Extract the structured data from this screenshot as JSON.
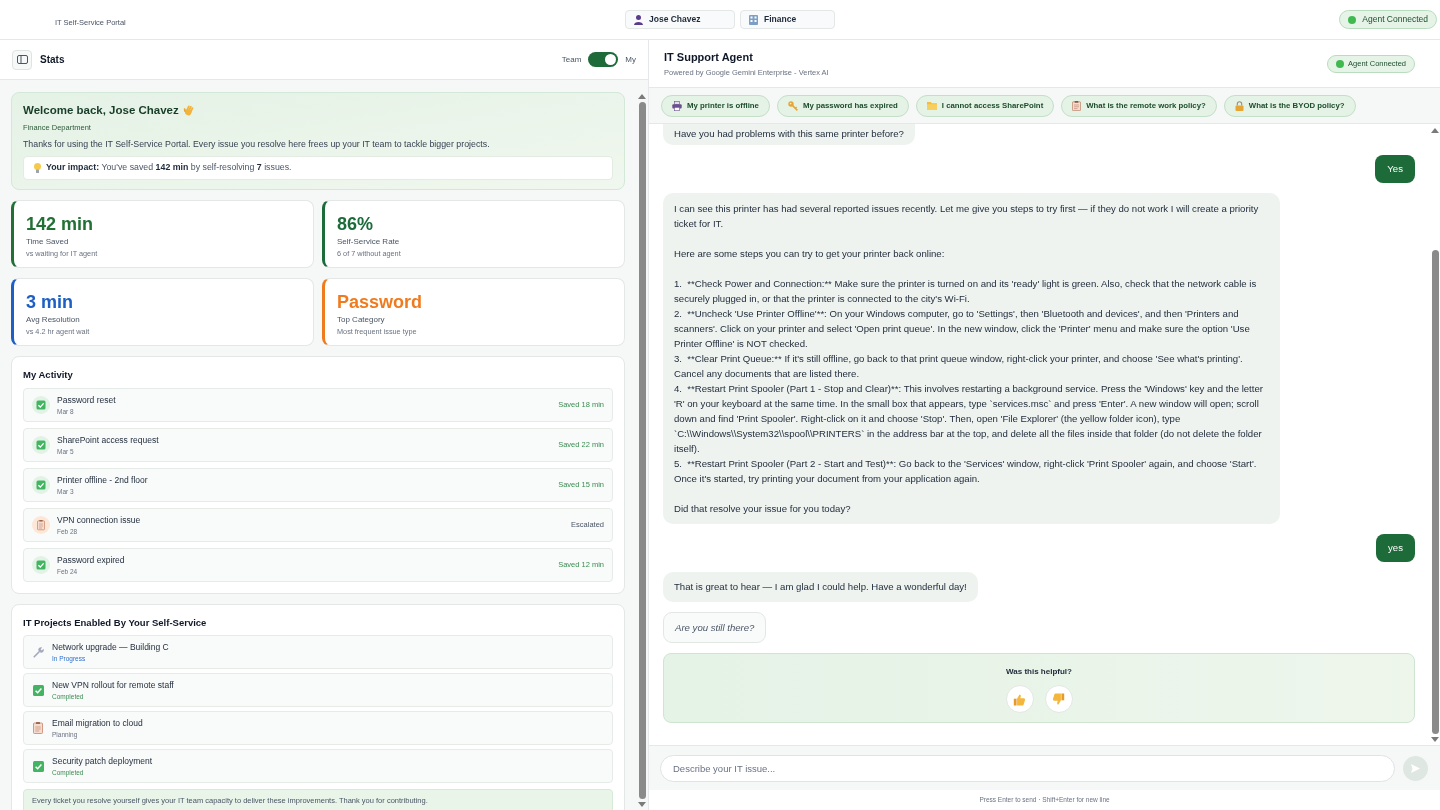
{
  "top_bar": {
    "app_title": "IT Self-Service Portal",
    "user": "Jose Chavez",
    "department": "Finance",
    "agent_status": {
      "label": "Agent Connected",
      "connected": true
    }
  },
  "stats_panel": {
    "title": "Stats",
    "toggle": {
      "left_label": "Team",
      "right_label": "My",
      "on": true
    },
    "welcome": {
      "title": "Welcome back, Jose Chavez",
      "department": "Finance Department",
      "message": "Thanks for using the IT Self-Service Portal. Every issue you resolve here frees up your IT team to tackle bigger projects.",
      "impact": "**Your impact:** You've saved **142 min** by self-resolving **7** issues."
    },
    "stat_cards": [
      {
        "value": "142 min",
        "label": "Time Saved",
        "note": "vs waiting for IT agent",
        "color": "#237035"
      },
      {
        "value": "86%",
        "label": "Self-Service Rate",
        "note": "6 of 7 without agent",
        "color": "#1c6b3a"
      },
      {
        "value": "3 min",
        "label": "Avg Resolution",
        "note": "vs 4.2 hr agent wait",
        "color": "#1d5fc4"
      },
      {
        "value": "Password",
        "label": "Top Category",
        "note": "Most frequent issue type",
        "color": "#f07b1f"
      }
    ],
    "activity": {
      "title": "My Activity",
      "items": [
        {
          "title": "Password reset",
          "date": "Mar 8",
          "kind": "resolved",
          "result": "Saved 18 min"
        },
        {
          "title": "SharePoint access request",
          "date": "Mar 5",
          "kind": "resolved",
          "result": "Saved 22 min"
        },
        {
          "title": "Printer offline - 2nd floor",
          "date": "Mar 3",
          "kind": "resolved",
          "result": "Saved 15 min"
        },
        {
          "title": "VPN connection issue",
          "date": "Feb 28",
          "kind": "escalated",
          "result": "Escalated"
        },
        {
          "title": "Password expired",
          "date": "Feb 24",
          "kind": "resolved",
          "result": "Saved 12 min"
        }
      ]
    },
    "projects": {
      "title": "IT Projects Enabled By Your Self-Service",
      "items": [
        {
          "title": "Network upgrade — Building C",
          "status": "In Progress",
          "kind": "in_progress"
        },
        {
          "title": "New VPN rollout for remote staff",
          "status": "Completed",
          "kind": "completed"
        },
        {
          "title": "Email migration to cloud",
          "status": "Planning",
          "kind": "planning"
        },
        {
          "title": "Security patch deployment",
          "status": "Completed",
          "kind": "completed"
        }
      ],
      "note": "Every ticket you resolve yourself gives your IT team capacity to deliver these improvements. Thank you for contributing."
    }
  },
  "chat": {
    "title": "IT Support Agent",
    "subtitle": "Powered by Google Gemini Enterprise - Vertex AI",
    "agent_status": {
      "label": "Agent Connected",
      "connected": true
    },
    "suggestions": [
      "My printer is offline",
      "My password has expired",
      "I cannot access SharePoint",
      "What is the remote work policy?",
      "What is the BYOD policy?"
    ],
    "messages": [
      {
        "kind": "agent",
        "paragraphs": [
          [
            "Have you had problems with this same printer before?"
          ]
        ]
      },
      {
        "kind": "user",
        "paragraphs": [
          [
            "Yes"
          ]
        ]
      },
      {
        "kind": "agent",
        "paragraphs": [
          [
            "I can see this printer has had several reported issues recently. Let me give you steps to try first — if they do not work I will create a priority ticket for IT."
          ],
          [
            "Here are some steps you can try to get your printer back online:"
          ],
          [
            "1.  **Check Power and Connection:** Make sure the printer is turned on and its 'ready' light is green. Also, check that the network cable is securely plugged in, or that the printer is connected to the city's Wi-Fi.",
            "2.  **Uncheck 'Use Printer Offline'**: On your Windows computer, go to 'Settings', then 'Bluetooth and devices', and then 'Printers and scanners'. Click on your printer and select 'Open print queue'. In the new window, click the 'Printer' menu and make sure the option 'Use Printer Offline' is NOT checked.",
            "3.  **Clear Print Queue:** If it's still offline, go back to that print queue window, right-click your printer, and choose 'See what's printing'. Cancel any documents that are listed there.",
            "4.  **Restart Print Spooler (Part 1 - Stop and Clear)**: This involves restarting a background service. Press the 'Windows' key and the letter 'R' on your keyboard at the same time. In the small box that appears, type `services.msc` and press 'Enter'. A new window will open; scroll down and find 'Print Spooler'. Right-click on it and choose 'Stop'. Then, open 'File Explorer' (the yellow folder icon), type `C:\\\\Windows\\\\System32\\\\spool\\\\PRINTERS` in the address bar at the top, and delete all the files inside that folder (do not delete the folder itself).",
            "5.  **Restart Print Spooler (Part 2 - Start and Test)**: Go back to the 'Services' window, right-click 'Print Spooler' again, and choose 'Start'. Once it's started, try printing your document from your application again."
          ],
          [
            "Did that resolve your issue for you today?"
          ]
        ]
      },
      {
        "kind": "user",
        "paragraphs": [
          [
            "yes"
          ]
        ]
      },
      {
        "kind": "agent",
        "paragraphs": [
          [
            "That is great to hear — I am glad I could help. Have a wonderful day!"
          ]
        ]
      },
      {
        "kind": "nudge",
        "paragraphs": [
          [
            "Are you still there?"
          ]
        ]
      }
    ],
    "feedback": {
      "question": "Was this helpful?"
    },
    "composer": {
      "placeholder": "Describe your IT issue...",
      "send_disabled": true,
      "hint": "Press Enter to send · Shift+Enter for new line"
    }
  }
}
